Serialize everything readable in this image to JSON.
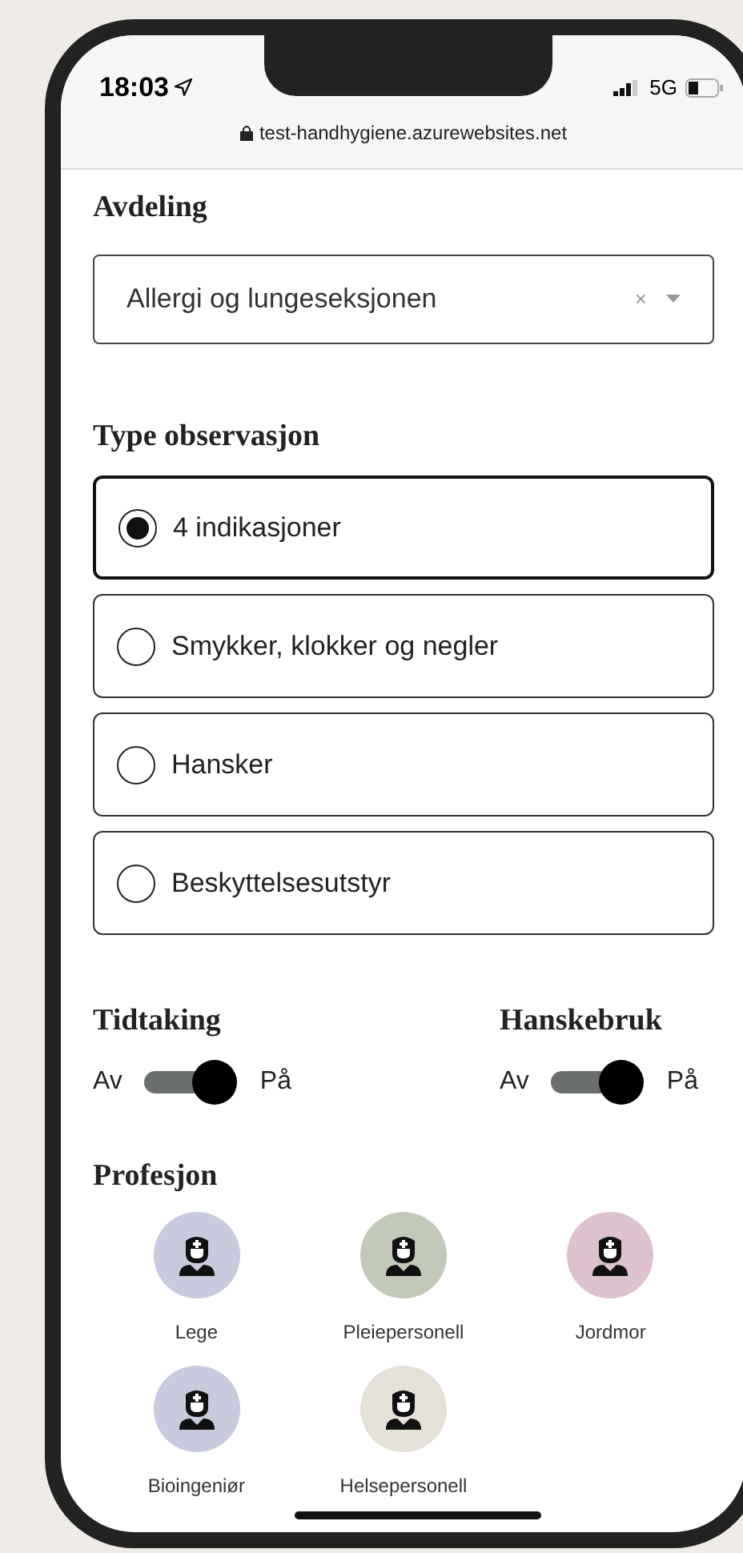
{
  "status_bar": {
    "time": "18:03",
    "network": "5G"
  },
  "browser": {
    "url": "test-handhygiene.azurewebsites.net"
  },
  "department": {
    "label": "Avdeling",
    "value": "Allergi og lungeseksjonen",
    "clear": "×"
  },
  "observation_type": {
    "label": "Type observasjon",
    "options": [
      {
        "label": "4 indikasjoner",
        "selected": true
      },
      {
        "label": "Smykker, klokker og negler",
        "selected": false
      },
      {
        "label": "Hansker",
        "selected": false
      },
      {
        "label": "Beskyttelsesutstyr",
        "selected": false
      }
    ]
  },
  "toggles": [
    {
      "label": "Tidtaking",
      "off_label": "Av",
      "on_label": "På",
      "on": true
    },
    {
      "label": "Hanskebruk",
      "off_label": "Av",
      "on_label": "På",
      "on": true
    }
  ],
  "profession": {
    "label": "Profesjon",
    "items": [
      {
        "label": "Lege",
        "color": "#c8cbdd"
      },
      {
        "label": "Pleiepersonell",
        "color": "#c3c9b8"
      },
      {
        "label": "Jordmor",
        "color": "#dec1cf"
      },
      {
        "label": "Bioingeniør",
        "color": "#c8cbdd"
      },
      {
        "label": "Helsepersonell",
        "color": "#e5e1d9"
      }
    ]
  }
}
